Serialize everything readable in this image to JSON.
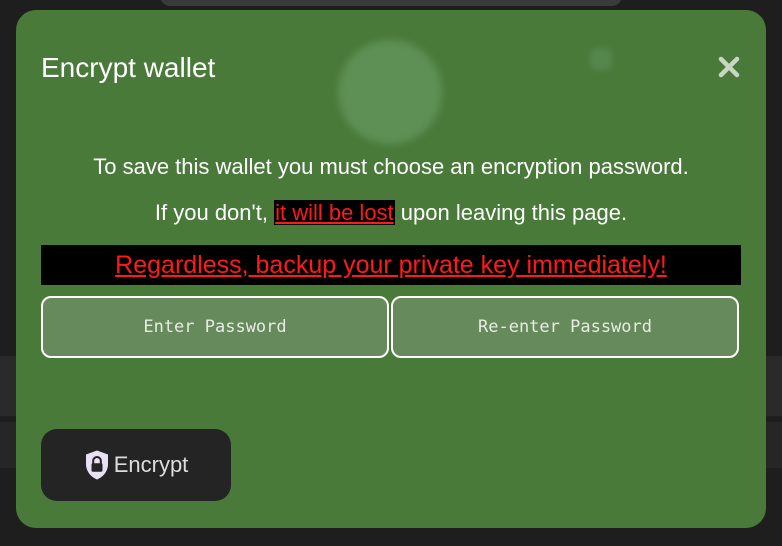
{
  "modal": {
    "title": "Encrypt wallet",
    "close_icon": "close-icon",
    "message_line1": "To save this wallet you must choose an encryption password.",
    "message_line2_prefix": "If you don't, ",
    "message_line2_emphasis": "it will be lost",
    "message_line2_suffix": " upon leaving this page.",
    "warning": "Regardless, backup your private key immediately!",
    "password_placeholder": "Enter Password",
    "password_value": "",
    "confirm_placeholder": "Re-enter Password",
    "confirm_value": "",
    "encrypt_label": "Encrypt",
    "encrypt_icon": "shield-lock-icon"
  },
  "colors": {
    "modal_bg": "#4a7a3a",
    "warning_red": "#ff1a1a",
    "banner_bg": "#000000",
    "button_bg": "#242424",
    "input_bg": "#678a5c"
  }
}
